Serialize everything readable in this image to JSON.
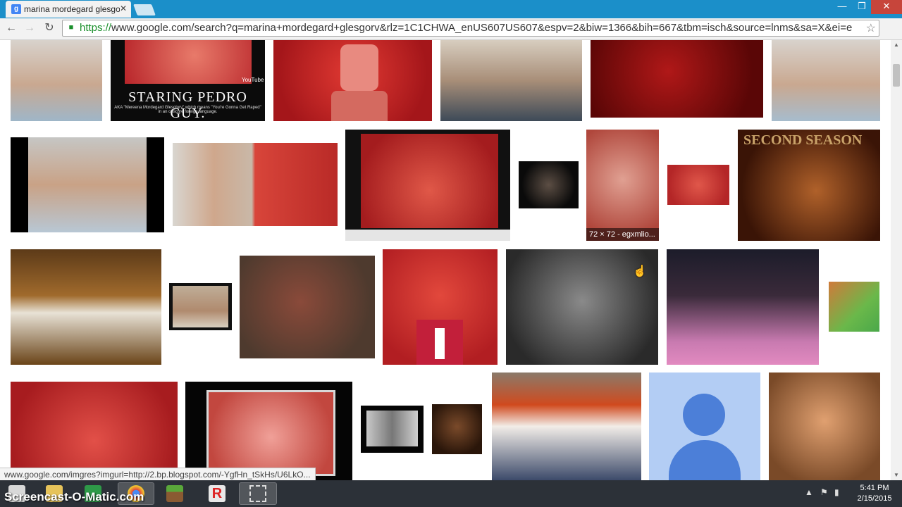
{
  "browser": {
    "tab_title": "marina mordegard glesgo",
    "tab_favicon": "g",
    "url_scheme": "https://",
    "url_rest": "www.google.com/search?q=marina+mordegard+glesgorv&rlz=1C1CHWA_enUS607US607&espv=2&biw=1366&bih=667&tbm=isch&source=lnms&sa=X&ei=e",
    "minimize": "—",
    "maximize": "❐",
    "close": "✕"
  },
  "images": {
    "staring_title": "STARING PEDRO GUY.",
    "staring_caption": "AKA \"Mereena Mordegard Glesglorv\" which means \"You're Gonna Get Raped\" in an obscure foreign language.",
    "staring_watermark": "YouTube",
    "poster_title": "SECOND SEASON",
    "hover_caption": "72 × 72 - egxmlio..."
  },
  "status_bar": {
    "url": "www.google.com/imgres?imgurl=http://2.bp.blogspot.com/-YgfHn_tSkHs/U6LkO..."
  },
  "taskbar": {
    "watermark": "Screencast-O-Matic.com",
    "time": "5:41 PM",
    "date": "2/15/2015"
  },
  "colors": {
    "titlebar": "#1b8fc9",
    "taskbar": "#2c3138",
    "close_button": "#c7453b"
  }
}
